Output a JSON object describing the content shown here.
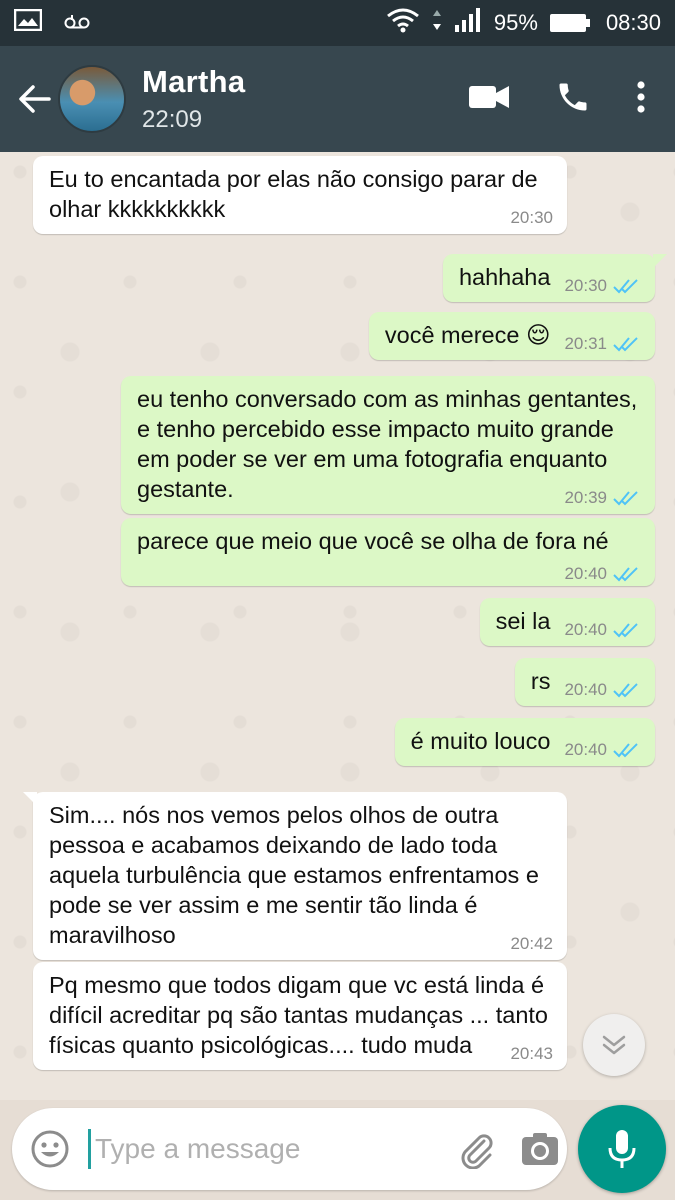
{
  "status_bar": {
    "battery": "95%",
    "time": "08:30",
    "icons": [
      "image-icon",
      "voicemail-icon",
      "wifi-icon",
      "signal-icon",
      "battery-icon"
    ]
  },
  "header": {
    "contact_name": "Martha",
    "subtitle": "22:09",
    "icons": [
      "back-arrow-icon",
      "video-call-icon",
      "phone-icon",
      "more-vert-icon"
    ]
  },
  "messages": [
    {
      "dir": "in",
      "text": "Eu to encantada por elas não consigo parar de olhar kkkkkkkkkk",
      "time": "20:30"
    },
    {
      "dir": "out",
      "text": "hahhaha",
      "time": "20:30"
    },
    {
      "dir": "out",
      "text": "você merece 😌",
      "time": "20:31"
    },
    {
      "dir": "out",
      "text": "eu tenho conversado com as minhas gentantes, e tenho percebido esse impacto muito grande em poder se ver em uma fotografia enquanto gestante.",
      "time": "20:39"
    },
    {
      "dir": "out",
      "text": "parece que meio que você se olha de fora né",
      "time": "20:40"
    },
    {
      "dir": "out",
      "text": "sei la",
      "time": "20:40"
    },
    {
      "dir": "out",
      "text": "rs",
      "time": "20:40"
    },
    {
      "dir": "out",
      "text": "é muito louco",
      "time": "20:40"
    },
    {
      "dir": "in",
      "text": "Sim.... nós nos vemos pelos olhos de outra pessoa e acabamos deixando de lado toda aquela turbulência que estamos enfrentamos e pode se ver assim e me sentir tão linda é maravilhoso",
      "time": "20:42"
    },
    {
      "dir": "in",
      "text": "Pq mesmo que todos digam que vc está linda é difícil acreditar pq são tantas mudanças ... tanto físicas quanto psicológicas.... tudo muda",
      "time": "20:43"
    }
  ],
  "composer": {
    "placeholder": "Type a message",
    "icons": [
      "emoji-icon",
      "attach-icon",
      "camera-icon",
      "mic-icon"
    ]
  },
  "colors": {
    "appbar": "#37474f",
    "statusbar": "#263238",
    "outgoing_bubble": "#dcf8c6",
    "incoming_bubble": "#ffffff",
    "read_ticks": "#4fc3f7",
    "mic_button": "#009688"
  }
}
